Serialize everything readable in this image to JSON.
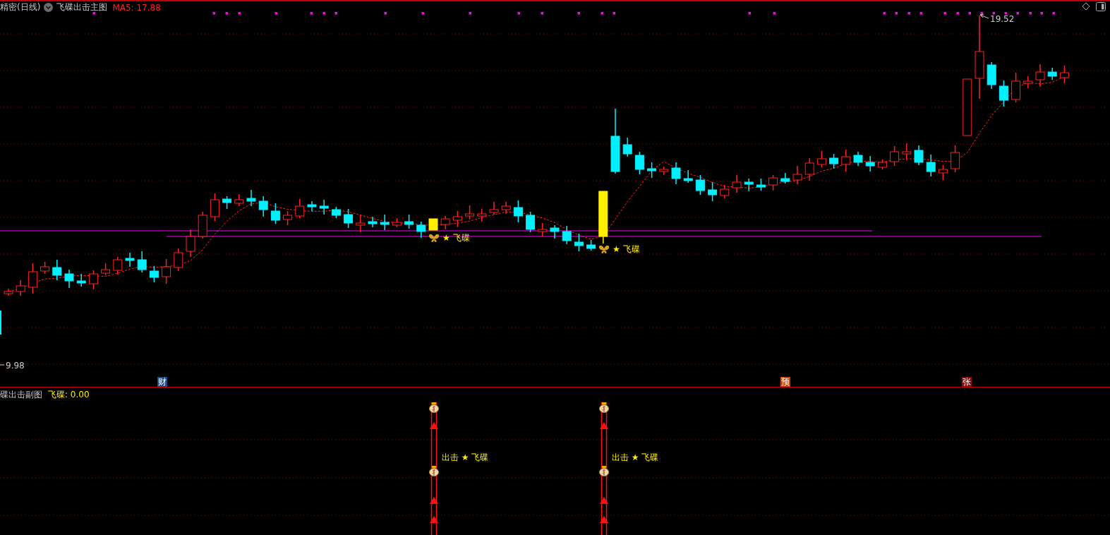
{
  "header": {
    "period": "精密(日线)",
    "indicator": "飞碟出击主图",
    "ma": "MA5: 17.88"
  },
  "price_labels": {
    "high": "19.52",
    "low": "9.98"
  },
  "event_markers": [
    {
      "label": "财",
      "color": "#1d4b86"
    },
    {
      "label": "预",
      "color": "#c2450e"
    },
    {
      "label": "张",
      "color": "#8a0c0c"
    }
  ],
  "signals": [
    {
      "label": "★ 飞碟"
    },
    {
      "label": "★ 飞碟"
    }
  ],
  "sub_panel": {
    "title": "碟出击副图",
    "value": "飞碟: 0.00",
    "signals": [
      {
        "label": "出击 ★ 飞碟"
      },
      {
        "label": "出击 ★ 飞碟"
      }
    ]
  }
}
